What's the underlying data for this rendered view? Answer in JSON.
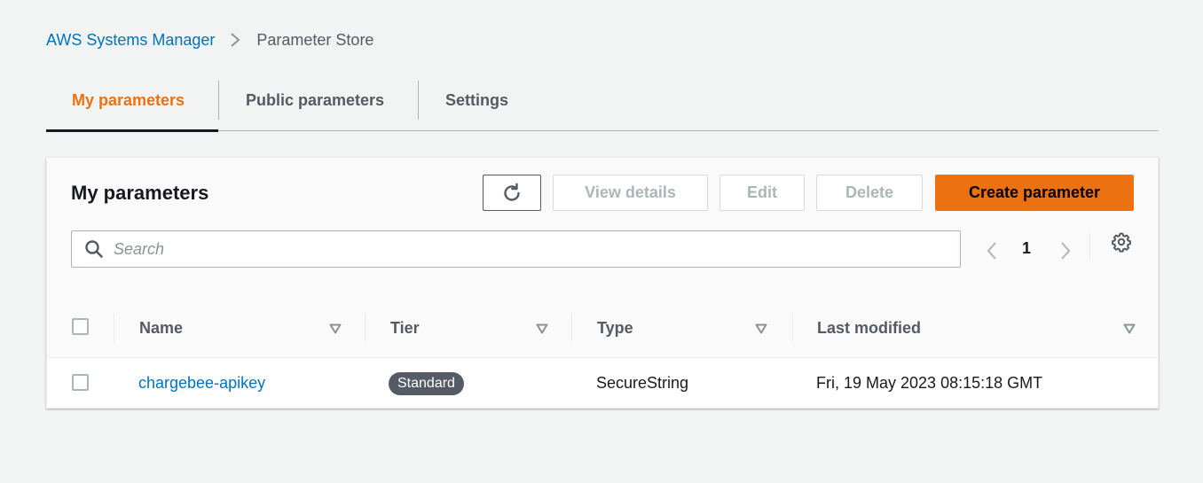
{
  "breadcrumb": {
    "root": "AWS Systems Manager",
    "current": "Parameter Store"
  },
  "tabs": [
    {
      "label": "My parameters",
      "active": true
    },
    {
      "label": "Public parameters",
      "active": false
    },
    {
      "label": "Settings",
      "active": false
    }
  ],
  "panel": {
    "title": "My parameters",
    "buttons": {
      "refresh_icon": "refresh-icon",
      "view_details": "View details",
      "edit": "Edit",
      "delete": "Delete",
      "create": "Create parameter"
    },
    "search": {
      "placeholder": "Search",
      "value": ""
    },
    "pagination": {
      "current_page": "1"
    }
  },
  "table": {
    "columns": [
      "Name",
      "Tier",
      "Type",
      "Last modified"
    ],
    "rows": [
      {
        "name": "chargebee-apikey",
        "tier": "Standard",
        "type": "SecureString",
        "last_modified": "Fri, 19 May 2023 08:15:18 GMT"
      }
    ]
  },
  "colors": {
    "accent": "#ec7211",
    "link": "#0073bb",
    "text_secondary": "#545b64",
    "background": "#f2f3f3"
  }
}
